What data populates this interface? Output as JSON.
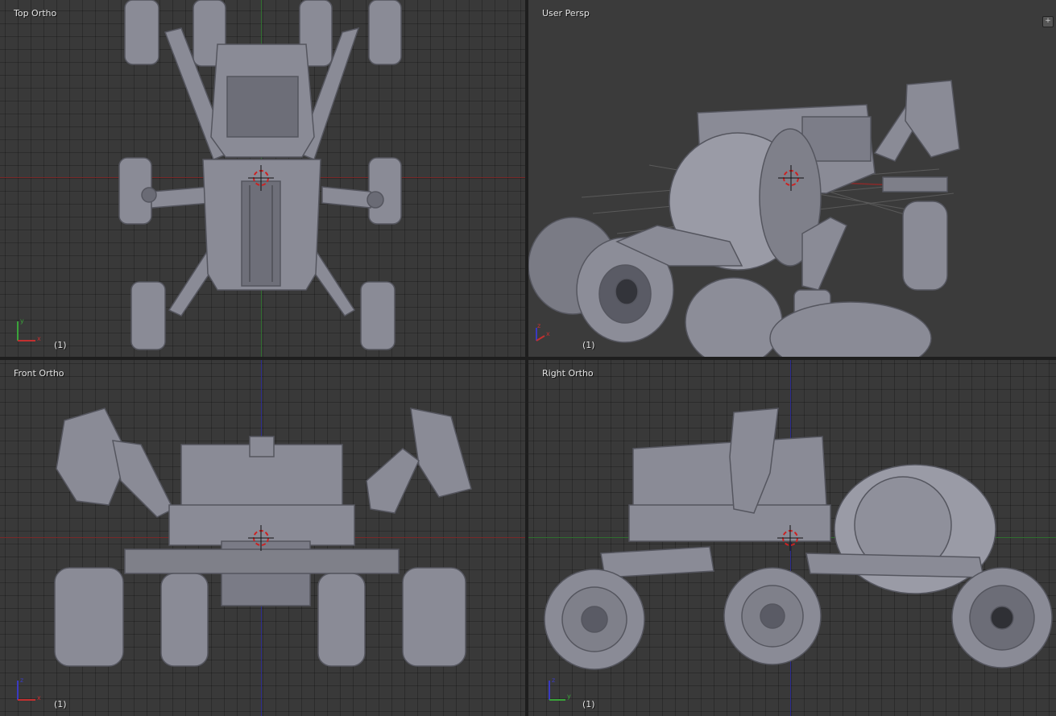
{
  "viewports": [
    {
      "id": "top",
      "label": "Top Ortho",
      "frame": "(1)",
      "gizmo": {
        "h": "x",
        "v": "y"
      }
    },
    {
      "id": "persp",
      "label": "User Persp",
      "frame": "(1)",
      "gizmo": {
        "h": "x",
        "v": "z"
      }
    },
    {
      "id": "front",
      "label": "Front Ortho",
      "frame": "(1)",
      "gizmo": {
        "h": "x",
        "v": "z"
      }
    },
    {
      "id": "right",
      "label": "Right Ortho",
      "frame": "(1)",
      "gizmo": {
        "h": "y",
        "v": "z"
      }
    }
  ],
  "colors": {
    "viewport_bg": "#393939",
    "x_axis": "#8a2a2a",
    "y_axis": "#2f7a2f",
    "z_axis": "#2b2b8f",
    "model": "#8a8b96",
    "model_dark": "#5d5e68",
    "model_light": "#b6b7c2"
  },
  "icons": [
    "view-options-icon",
    "3d-cursor-icon",
    "axis-gizmo-icon"
  ]
}
